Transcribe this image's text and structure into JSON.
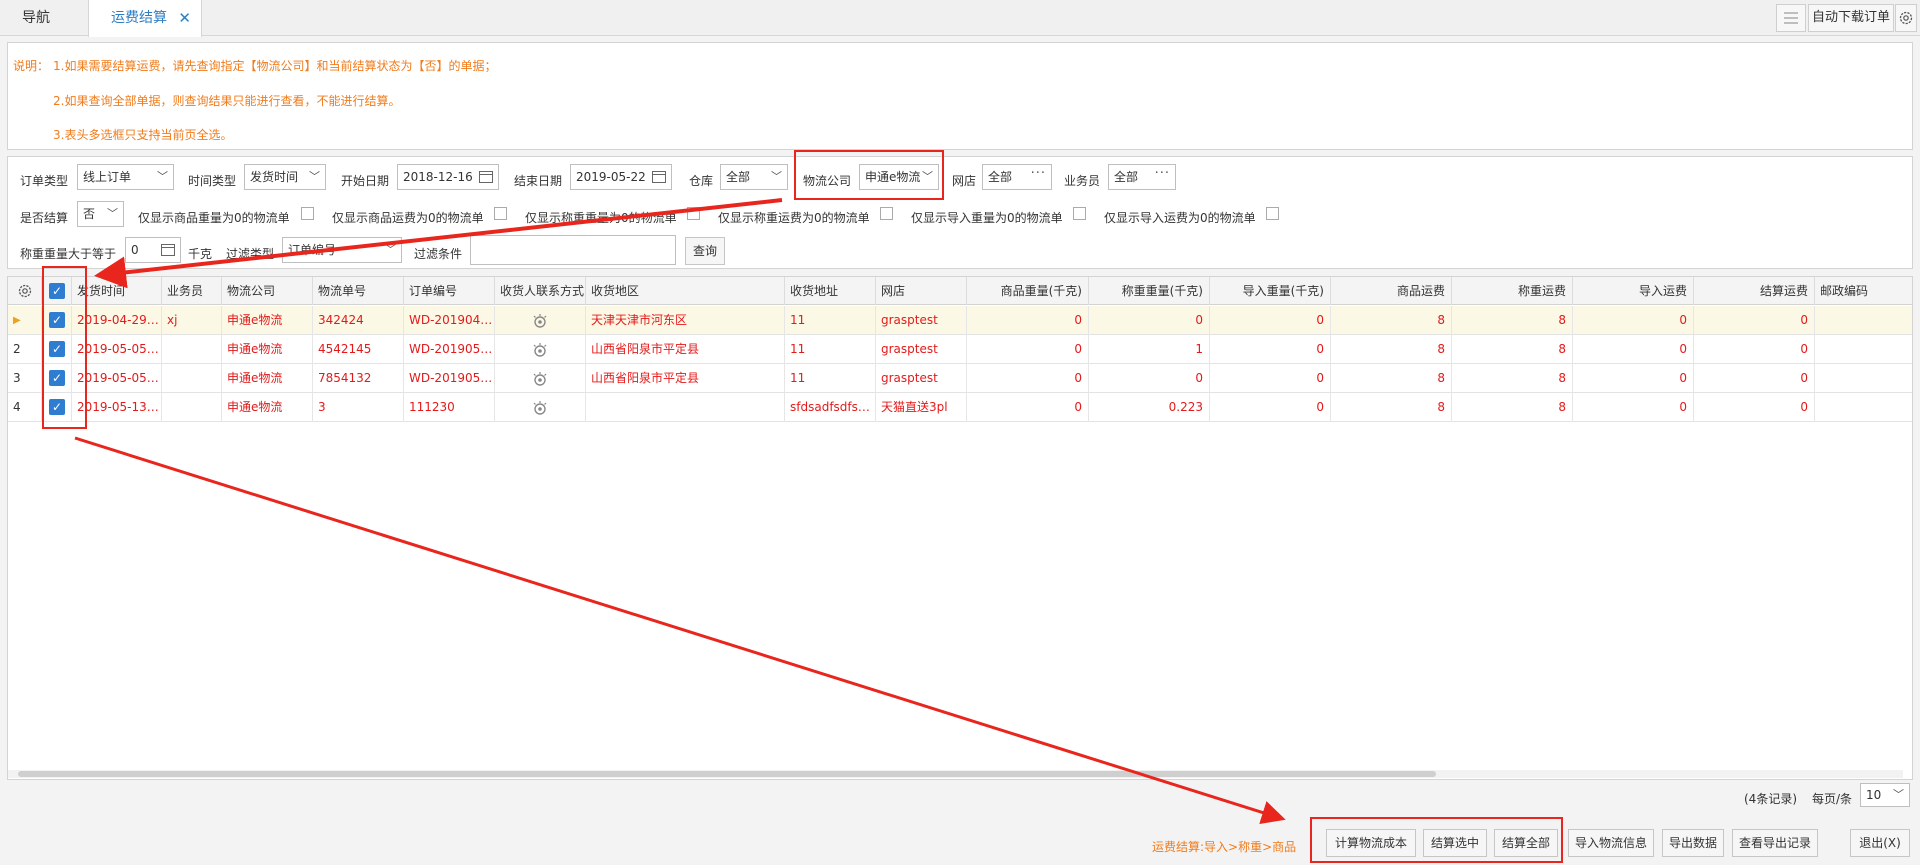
{
  "tabs": {
    "nav_label": "导航",
    "freight_label": "运费结算",
    "close": "✕"
  },
  "toolbar": {
    "auto_download_label": "自动下载订单"
  },
  "notes": {
    "label": "说明：",
    "line1": "1.如果需要结算运费，请先查询指定【物流公司】和当前结算状态为【否】的单据；",
    "line2": "2.如果查询全部单据，则查询结果只能进行查看，不能进行结算。",
    "line3": "3.表头多选框只支持当前页全选。"
  },
  "filter": {
    "order_type_label": "订单类型",
    "order_type_value": "线上订单",
    "time_type_label": "时间类型",
    "time_type_value": "发货时间",
    "start_date_label": "开始日期",
    "start_date_value": "2018-12-16",
    "end_date_label": "结束日期",
    "end_date_value": "2019-05-22",
    "warehouse_label": "仓库",
    "warehouse_value": "全部",
    "logistics_label": "物流公司",
    "logistics_value": "申通e物流",
    "shop_label": "网店",
    "shop_value": "全部",
    "salesman_label": "业务员",
    "salesman_value": "全部",
    "settled_label": "是否结算",
    "settled_value": "否",
    "opt1": "仅显示商品重量为0的物流单",
    "opt2": "仅显示商品运费为0的物流单",
    "opt3": "仅显示称重重量为0的物流单",
    "opt4": "仅显示称重运费为0的物流单",
    "opt5": "仅显示导入重量为0的物流单",
    "opt6": "仅显示导入运费为0的物流单",
    "weight_label": "称重重量大于等于",
    "weight_value": "0",
    "weight_unit": "千克",
    "filter_type_label": "过滤类型",
    "filter_type_value": "订单编号",
    "filter_cond_label": "过滤条件",
    "filter_cond_value": "",
    "query_label": "查询"
  },
  "grid": {
    "headers": [
      "发货时间",
      "业务员",
      "物流公司",
      "物流单号",
      "订单编号",
      "收货人联系方式",
      "收货地区",
      "收货地址",
      "网店",
      "商品重量(千克)",
      "称重重量(千克)",
      "导入重量(千克)",
      "商品运费",
      "称重运费",
      "导入运费",
      "结算运费",
      "邮政编码"
    ],
    "rows": [
      {
        "idx": "",
        "time": "2019-04-29 1...",
        "salesman": "xj",
        "company": "申通e物流",
        "tracking": "342424",
        "order": "WD-2019042...",
        "region": "天津天津市河东区",
        "address": "11",
        "shop": "grasptest",
        "w_goods": "0",
        "w_weigh": "0",
        "w_import": "0",
        "f_goods": "8",
        "f_weigh": "8",
        "f_import": "0",
        "f_settle": "0"
      },
      {
        "idx": "2",
        "time": "2019-05-05 1...",
        "salesman": "",
        "company": "申通e物流",
        "tracking": "4542145",
        "order": "WD-2019050...",
        "region": "山西省阳泉市平定县",
        "address": "11",
        "shop": "grasptest",
        "w_goods": "0",
        "w_weigh": "1",
        "w_import": "0",
        "f_goods": "8",
        "f_weigh": "8",
        "f_import": "0",
        "f_settle": "0"
      },
      {
        "idx": "3",
        "time": "2019-05-05 1...",
        "salesman": "",
        "company": "申通e物流",
        "tracking": "7854132",
        "order": "WD-2019050...",
        "region": "山西省阳泉市平定县",
        "address": "11",
        "shop": "grasptest",
        "w_goods": "0",
        "w_weigh": "0",
        "w_import": "0",
        "f_goods": "8",
        "f_weigh": "8",
        "f_import": "0",
        "f_settle": "0"
      },
      {
        "idx": "4",
        "time": "2019-05-13 1...",
        "salesman": "",
        "company": "申通e物流",
        "tracking": "3",
        "order": "111230",
        "region": "",
        "address": "sfdsadfsdfsdf...",
        "shop": "天猫直送3pl",
        "w_goods": "0",
        "w_weigh": "0.223",
        "w_import": "0",
        "f_goods": "8",
        "f_weigh": "8",
        "f_import": "0",
        "f_settle": "0"
      }
    ]
  },
  "pager": {
    "records": "(4条记录)",
    "per_page_label": "每页/条",
    "per_page_value": "10"
  },
  "footer": {
    "hint": "运费结算:导入>称重>商品",
    "calc_cost": "计算物流成本",
    "settle_selected": "结算选中",
    "settle_all": "结算全部",
    "import_info": "导入物流信息",
    "export_data": "导出数据",
    "view_export_log": "查看导出记录",
    "exit": "退出(X)"
  },
  "colors": {
    "accent": "#2d7ec4",
    "note": "#f07c1c",
    "row_text": "#e41a1a",
    "annotation": "#e8261d"
  }
}
